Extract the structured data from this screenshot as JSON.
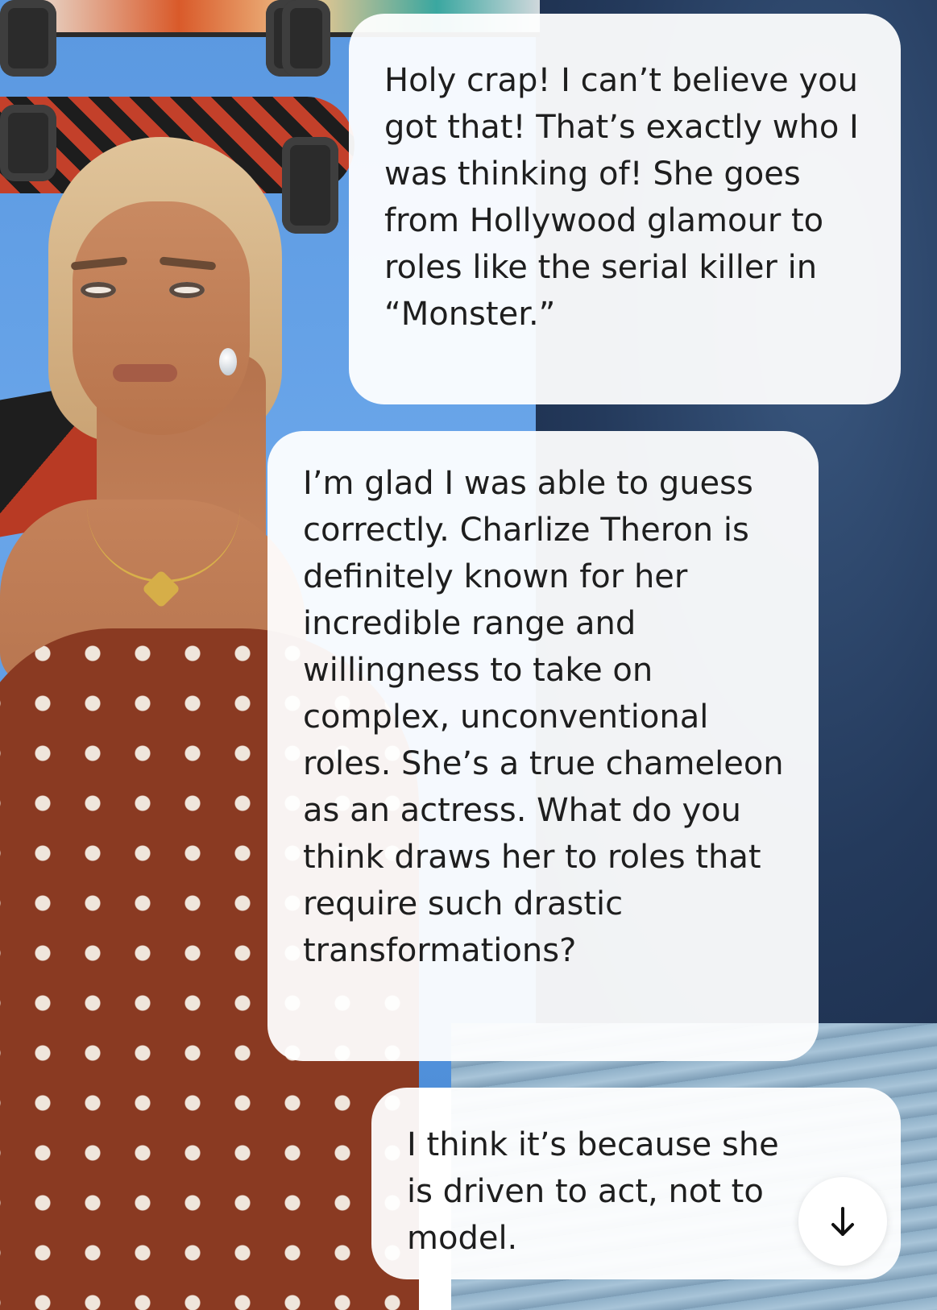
{
  "chat": {
    "messages": [
      {
        "role": "user",
        "text": "Holy crap! I can’t believe you got that! That’s exactly who I was thinking of! She goes from Hollywood glamour to roles like the serial killer in “Monster.”"
      },
      {
        "role": "assistant",
        "text": "I’m glad I was able to guess correctly. Charlize Theron is definitely known for her incredible range and willingness to take on complex, unconventional roles. She’s a true chameleon as an actress. What do you think draws her to roles that require such drastic transformations?"
      },
      {
        "role": "user",
        "text": "I think it’s because she is driven to act, not to model."
      }
    ],
    "scroll_button": {
      "icon": "arrow-down-icon"
    }
  },
  "colors": {
    "bubble_background": "#ffffff",
    "text": "#1e1e1e",
    "dress": "#8a3a22",
    "wall": "#5a98e0"
  }
}
